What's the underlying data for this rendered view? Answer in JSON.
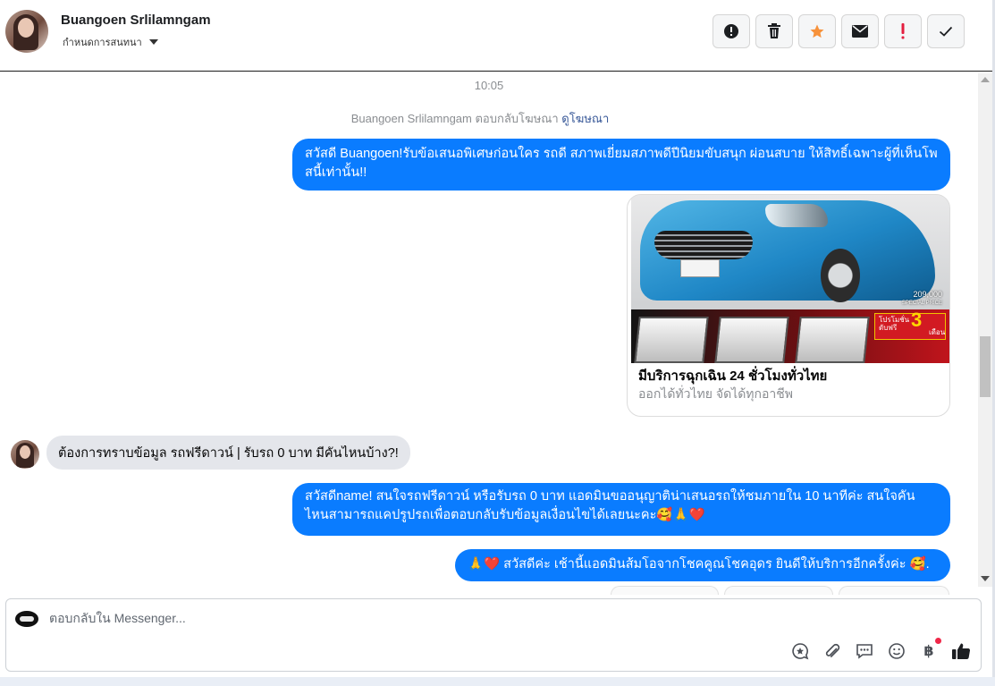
{
  "header": {
    "contact_name": "Buangoen Srlilamngam",
    "assign_label": "กำหนดการสนทนา"
  },
  "actions": [
    {
      "name": "mark-spam-button",
      "icon": "alert-circle-icon"
    },
    {
      "name": "delete-button",
      "icon": "trash-icon"
    },
    {
      "name": "star-button",
      "icon": "star-icon"
    },
    {
      "name": "mark-unread-button",
      "icon": "envelope-icon"
    },
    {
      "name": "follow-up-button",
      "icon": "exclamation-icon"
    },
    {
      "name": "mark-done-button",
      "icon": "check-icon"
    }
  ],
  "colors": {
    "accent": "#0a7cff",
    "star": "#f7923b",
    "alert": "#e41e3f"
  },
  "thread": {
    "timestamp": "10:05",
    "system_prefix": "Buangoen Srlilamngam ตอบกลับโฆษณา",
    "system_link": "ดูโฆษณา",
    "msg1": "สวัสดี Buangoen!รับข้อเสนอพิเศษก่อนใคร รถดี สภาพเยี่ยมสภาพดีปีนิยมขับสนุก ผ่อนสบาย ให้สิทธิ์เฉพาะผู้ที่เห็นโพสนี้เท่านั้น!!",
    "card": {
      "title": "มีบริการฉุกเฉิน 24 ชั่วโมงทั่วไทย",
      "subtitle": "ออกได้ทั่วไทย จัดได้ทุกอาชีพ",
      "price_line1": "209,000",
      "price_line2": "SPECIAL PRICE",
      "promo_line1": "โปรโมชั่น",
      "promo_line2": "ดับฟรี",
      "promo_number": "3",
      "promo_line3": "เดือน"
    },
    "msg2": "ต้องการทราบข้อมูล รถฟรีดาวน์ | รับรถ 0 บาท มีคันไหนบ้าง?!",
    "msg3": "สวัสดีname! สนใจรถฟรีดาวน์ หรือรับรถ 0 บาท แอดมินขออนุญาติน่าเสนอรถให้ชมภายใน 10 นาทีค่ะ สนใจคันไหนสามารถแคปรูปรถเพื่อตอบกลับรับข้อมูลเงื่อนไขได้เลยนะคะ🥰🙏❤️",
    "msg4": "🙏❤️ สวัสดีค่ะ เช้านี้แอดมินส้มโอจากโชคคูณโชคอุดร ยินดีให้บริการอีกครั้งค่ะ  🥰."
  },
  "composer": {
    "placeholder": "ตอบกลับใน Messenger...",
    "baht_symbol": "฿"
  }
}
